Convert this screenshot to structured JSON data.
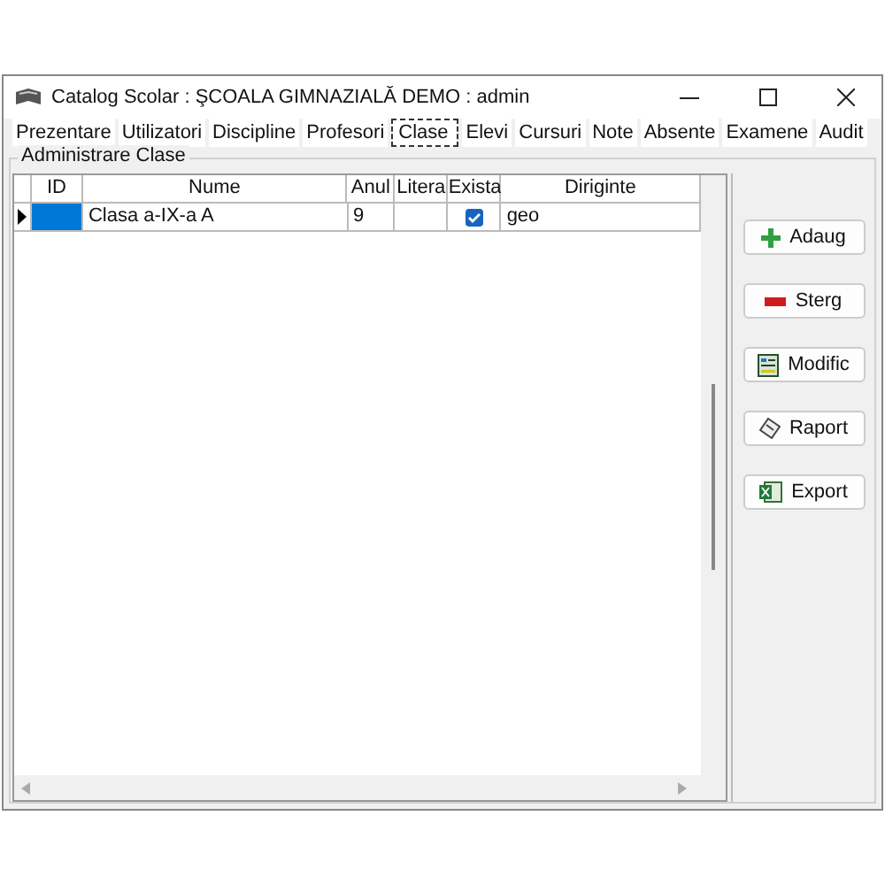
{
  "window": {
    "title": "Catalog Scolar : ŞCOALA GIMNAZIALĂ DEMO : admin"
  },
  "tabs": [
    {
      "label": "Prezentare",
      "selected": false
    },
    {
      "label": "Utilizatori",
      "selected": false
    },
    {
      "label": "Discipline",
      "selected": false
    },
    {
      "label": "Profesori",
      "selected": false
    },
    {
      "label": "Clase",
      "selected": true
    },
    {
      "label": "Elevi",
      "selected": false
    },
    {
      "label": "Cursuri",
      "selected": false
    },
    {
      "label": "Note",
      "selected": false
    },
    {
      "label": "Absente",
      "selected": false
    },
    {
      "label": "Examene",
      "selected": false
    },
    {
      "label": "Audit",
      "selected": false
    }
  ],
  "group": {
    "title": "Administrare Clase"
  },
  "table": {
    "columns": [
      "ID",
      "Nume",
      "Anul",
      "Litera",
      "Exista",
      "Diriginte"
    ],
    "rows": [
      {
        "nume": "Clasa a-IX-a A",
        "anul": "9",
        "exista": true,
        "diriginte": "geo",
        "selected": true
      }
    ]
  },
  "buttons": [
    {
      "label": "Adaug",
      "kind": "add"
    },
    {
      "label": "Sterg",
      "kind": "delete"
    },
    {
      "label": "Modific",
      "kind": "edit"
    },
    {
      "label": "Raport",
      "kind": "report"
    },
    {
      "label": "Export",
      "kind": "export"
    }
  ]
}
